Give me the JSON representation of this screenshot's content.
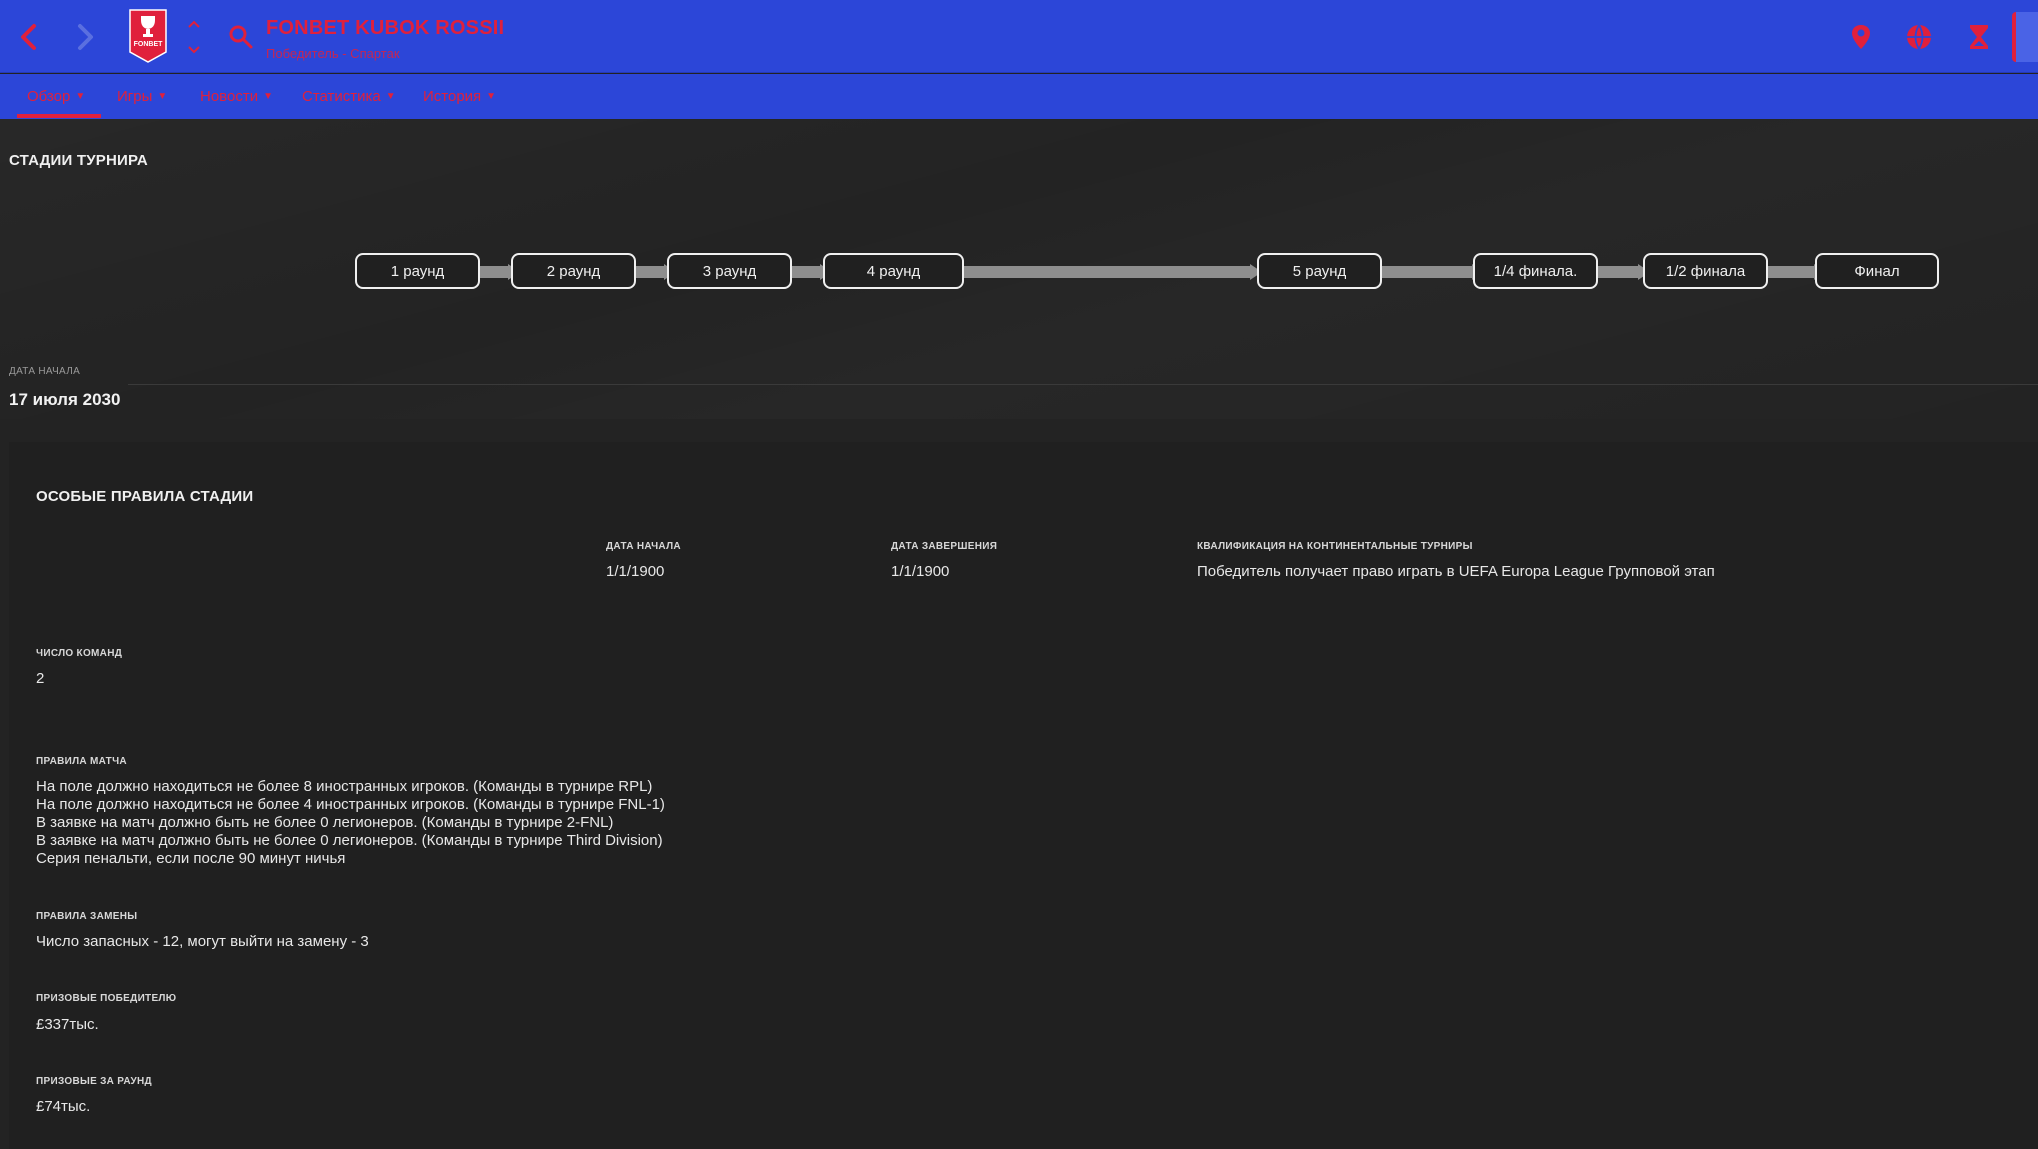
{
  "header": {
    "title": "FONBET KUBOK ROSSII",
    "subtitle": "Победитель - Спартак",
    "logo_text": "FONBET",
    "colors": {
      "bar": "#2c46d8",
      "accent": "#e0203c"
    },
    "icons": [
      "back-arrow-icon",
      "forward-arrow-icon",
      "up-down-arrows-icon",
      "search-icon",
      "location-pin-icon",
      "globe-icon",
      "hourglass-icon"
    ]
  },
  "tabs": [
    {
      "label": "Обзор"
    },
    {
      "label": "Игры"
    },
    {
      "label": "Новости"
    },
    {
      "label": "Статистика"
    },
    {
      "label": "История"
    }
  ],
  "stages_section": {
    "title": "СТАДИИ ТУРНИРА",
    "stages": [
      "1 раунд",
      "2 раунд",
      "3 раунд",
      "4 раунд",
      "5 раунд",
      "1/4 финала.",
      "1/2 финала",
      "Финал"
    ]
  },
  "start": {
    "label": "ДАТА НАЧАЛА",
    "value": "17 июля 2030"
  },
  "rules": {
    "title": "ОСОБЫЕ ПРАВИЛА СТАДИИ",
    "start_label": "ДАТА НАЧАЛА",
    "start_value": "1/1/1900",
    "end_label": "ДАТА ЗАВЕРШЕНИЯ",
    "end_value": "1/1/1900",
    "qual_label": "КВАЛИФИКАЦИЯ НА КОНТИНЕНТАЛЬНЫЕ ТУРНИРЫ",
    "qual_value": "Победитель получает право играть в UEFA Europa League Групповой этап",
    "teams_label": "ЧИСЛО КОМАНД",
    "teams_value": "2",
    "match_rules_label": "ПРАВИЛА МАТЧА",
    "match_rules": [
      "На поле должно находиться не более 8 иностранных игроков.  (Команды в турнире RPL)",
      "На поле должно находиться не более 4 иностранных игроков.  (Команды в турнире FNL-1)",
      "В заявке на матч должно быть не более 0 легионеров.  (Команды в турнире 2-FNL)",
      "В заявке на матч должно быть не более 0 легионеров.  (Команды в турнире Third Division)",
      "Серия пенальти, если после 90 минут ничья"
    ],
    "subs_label": "ПРАВИЛА ЗАМЕНЫ",
    "subs_value": "Число запасных - 12, могут выйти на замену - 3",
    "prize_winner_label": "ПРИЗОВЫЕ ПОБЕДИТЕЛЮ",
    "prize_winner_value": "£337тыс.",
    "prize_round_label": "ПРИЗОВЫЕ ЗА РАУНД",
    "prize_round_value": "£74тыс."
  }
}
